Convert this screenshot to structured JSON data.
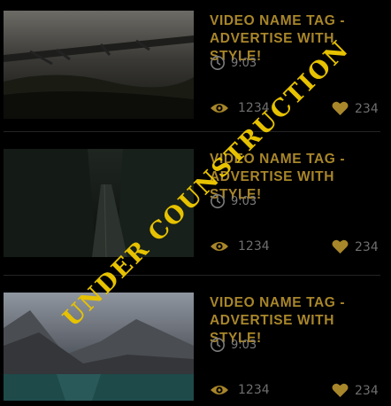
{
  "videos": [
    {
      "title": "VIDEO NAME TAG - ADVERTISE WITH STYLE!",
      "duration": "9:03",
      "views": "1234",
      "likes": "234",
      "thumbnail": "foggy-bridge-forest-thumbnail"
    },
    {
      "title": "VIDEO NAME TAG - ADVERTISE WITH STYLE!",
      "duration": "9:03",
      "views": "1234",
      "likes": "234",
      "thumbnail": "forest-path-thumbnail"
    },
    {
      "title": "VIDEO NAME TAG - ADVERTISE WITH STYLE!",
      "duration": "9:03",
      "views": "1234",
      "likes": "234",
      "thumbnail": "mountain-lake-thumbnail"
    }
  ],
  "overlay": {
    "text": "UNDER COUNSTRUCTION"
  },
  "colors": {
    "accent": "#a8862a",
    "stamp": "#e7c200",
    "muted": "#6e6e6e",
    "background": "#000000"
  },
  "icons": {
    "duration": "clock-icon",
    "views": "eye-icon",
    "likes": "heart-icon"
  }
}
